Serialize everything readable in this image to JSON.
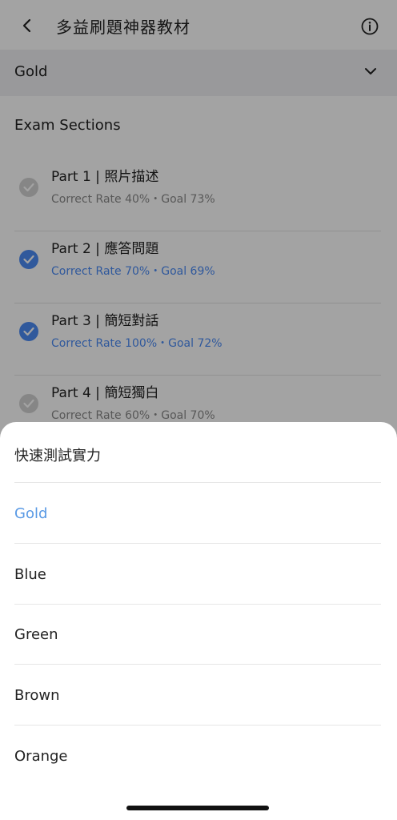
{
  "header": {
    "title": "多益刷題神器教材",
    "back_icon": "chevron-left-icon",
    "info_icon": "info-icon"
  },
  "level_selector": {
    "value": "Gold",
    "icon": "chevron-down-icon"
  },
  "sections": {
    "title": "Exam Sections",
    "items": [
      {
        "title": "Part 1 | 照片描述",
        "subtitle": "Correct Rate 40%・Goal 73%",
        "checked": false
      },
      {
        "title": "Part 2 | 應答問題",
        "subtitle": "Correct Rate 70%・Goal 69%",
        "checked": true
      },
      {
        "title": "Part 3 | 簡短對話",
        "subtitle": "Correct Rate 100%・Goal 72%",
        "checked": true
      },
      {
        "title": "Part 4 | 簡短獨白",
        "subtitle": "Correct Rate 60%・Goal 70%",
        "checked": false
      }
    ]
  },
  "sheet": {
    "options": [
      {
        "label": "快速測試實力",
        "selected": false
      },
      {
        "label": "Gold",
        "selected": true
      },
      {
        "label": "Blue",
        "selected": false
      },
      {
        "label": "Green",
        "selected": false
      },
      {
        "label": "Brown",
        "selected": false
      },
      {
        "label": "Orange",
        "selected": false
      }
    ]
  },
  "colors": {
    "accent": "#4c8bf5",
    "selected_option": "#5a9ae5",
    "overlay": "rgba(0,0,0,0.36)"
  }
}
